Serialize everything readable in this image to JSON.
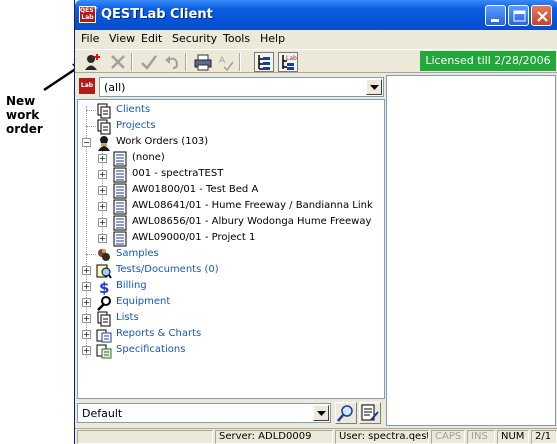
{
  "annotation": {
    "label": "New work order"
  },
  "window": {
    "title": "QESTLab Client",
    "icon_text": "QEST Lab",
    "controls": [
      "minimize-icon",
      "maximize-icon",
      "close-icon"
    ]
  },
  "menu": [
    "File",
    "View",
    "Edit",
    "Security",
    "Tools",
    "Help"
  ],
  "toolbar": {
    "buttons": [
      "new-work-order-icon",
      "delete-icon",
      "check-icon",
      "undo-icon",
      "print-icon",
      "spell-icon",
      "tree-view-icon",
      "lab-tree-icon"
    ],
    "license_text": "Licensed till 2/28/2006"
  },
  "lab_selector": {
    "badge": "Lab",
    "value": "(all)"
  },
  "tree": {
    "clients": "Clients",
    "projects": "Projects",
    "work_orders": "Work Orders (103)",
    "work_order_items": [
      "(none)",
      "001 - spectraTEST",
      "AW01800/01 - Test Bed A",
      "AWL08641/01 - Hume Freeway / Bandianna Link",
      "AWL08656/01 - Albury Wodonga Hume Freeway",
      "AWL09000/01 - Project 1"
    ],
    "samples": "Samples",
    "tests_documents": "Tests/Documents (0)",
    "billing": "Billing",
    "equipment": "Equipment",
    "lists": "Lists",
    "reports_charts": "Reports & Charts",
    "specifications": "Specifications"
  },
  "filter": {
    "value": "Default"
  },
  "status": {
    "server": "Server: ADLD0009",
    "user": "User: spectra.qest",
    "caps": "CAPS",
    "ins": "INS",
    "num": "NUM",
    "page": "2/1"
  },
  "colors": {
    "license_bg": "#21a73a",
    "link_blue": "#1b56b8",
    "title_blue": "#0553d8"
  }
}
